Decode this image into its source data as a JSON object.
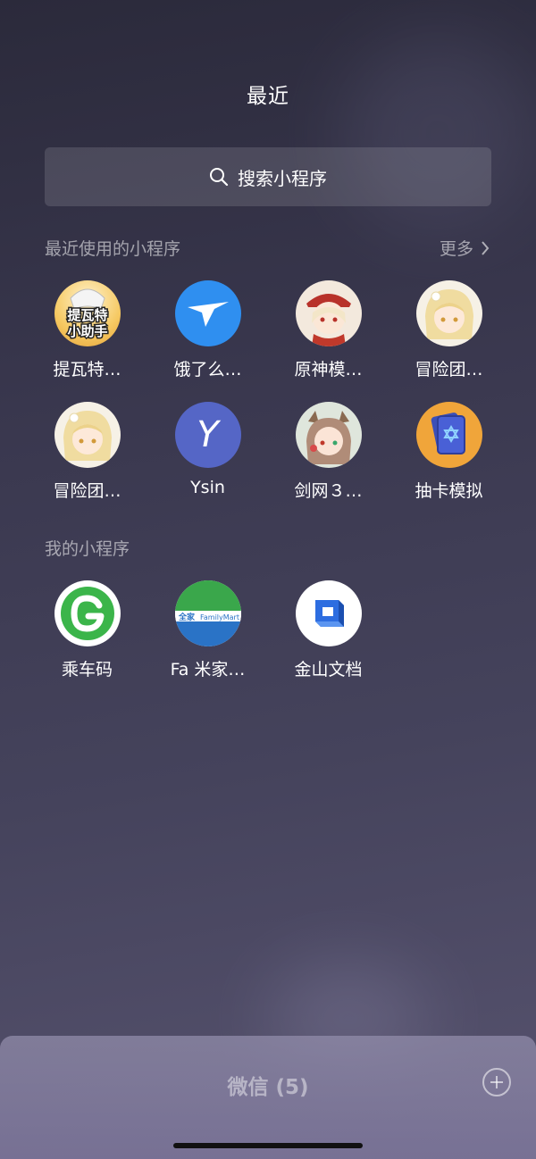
{
  "page": {
    "title": "最近"
  },
  "search": {
    "label": "搜索小程序",
    "icon": "search-icon"
  },
  "recent": {
    "title": "最近使用的小程序",
    "more_label": "更多",
    "apps": [
      {
        "name": "提瓦特…",
        "icon": "tivat-helper-icon"
      },
      {
        "name": "饿了么…",
        "icon": "eleme-bird-icon"
      },
      {
        "name": "原神模…",
        "icon": "genshin-character-icon"
      },
      {
        "name": "冒险团…",
        "icon": "lumine-avatar-icon"
      },
      {
        "name": "冒险团…",
        "icon": "lumine-avatar-icon"
      },
      {
        "name": "Ysin",
        "icon": "ysin-y-icon"
      },
      {
        "name": "剑网３…",
        "icon": "jx3-character-icon"
      },
      {
        "name": "抽卡模拟",
        "icon": "card-draw-icon"
      }
    ]
  },
  "mine": {
    "title": "我的小程序",
    "apps": [
      {
        "name": "乘车码",
        "icon": "transit-code-icon"
      },
      {
        "name": "Fa 米家…",
        "icon": "familymart-icon"
      },
      {
        "name": "金山文档",
        "icon": "kingsoft-docs-icon"
      }
    ]
  },
  "icon_text": {
    "tivat_line1": "提瓦特",
    "tivat_line2": "小助手",
    "familymart_cn": "全家",
    "familymart_en": "FamilyMart",
    "ysin_letter": "Y"
  },
  "bottom": {
    "title": "微信 (5)"
  },
  "colors": {
    "eleme_blue": "#2f8ff0",
    "ysin_blue": "#5566c6",
    "transit_green": "#3bb54a",
    "familymart_green": "#3aa74b",
    "familymart_blue": "#2a73c6",
    "kingsoft_blue": "#2d6de0"
  }
}
